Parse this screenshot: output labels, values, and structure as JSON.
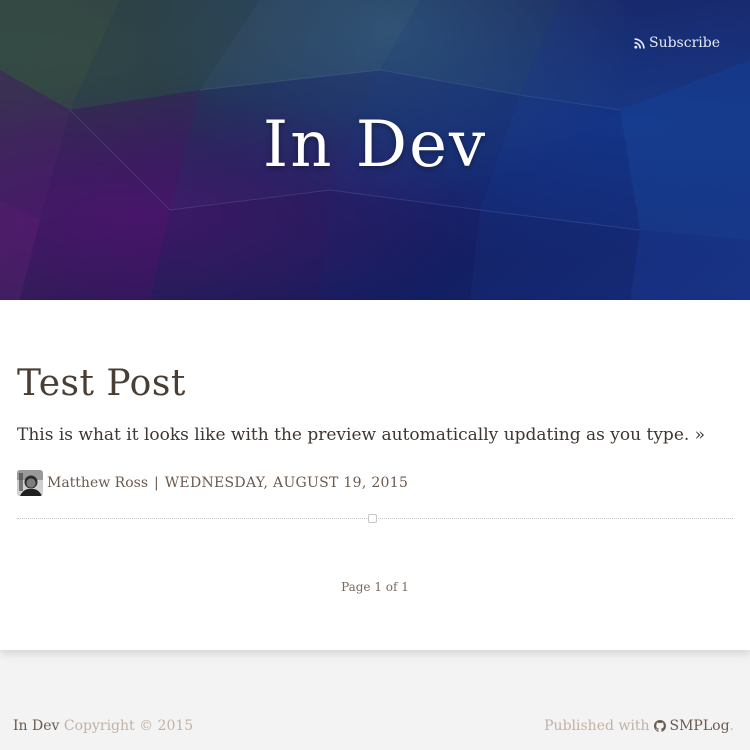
{
  "header": {
    "subscribe_label": "Subscribe",
    "subscribe_icon": "rss-icon",
    "site_title": "In Dev"
  },
  "post": {
    "title": "Test Post",
    "excerpt": "This is what it looks like with the preview automatically updating as you type. »",
    "author": "Matthew Ross",
    "separator": "|",
    "date": "WEDNESDAY, AUGUST 19, 2015"
  },
  "pagination": {
    "label": "Page 1 of 1"
  },
  "footer": {
    "site_link": "In Dev",
    "copyright": " Copyright © 2015",
    "published_text": "Published with",
    "github_icon": "github-icon",
    "platform_link": "SMPLog",
    "platform_suffix": "."
  },
  "colors": {
    "header_deep_blue": "#111a5a",
    "header_purple": "#55146e",
    "card_bg": "#ffffff",
    "page_bg": "#f3f3f3",
    "title_brown": "#4a3d34",
    "muted_tan": "#c2b2a4"
  }
}
